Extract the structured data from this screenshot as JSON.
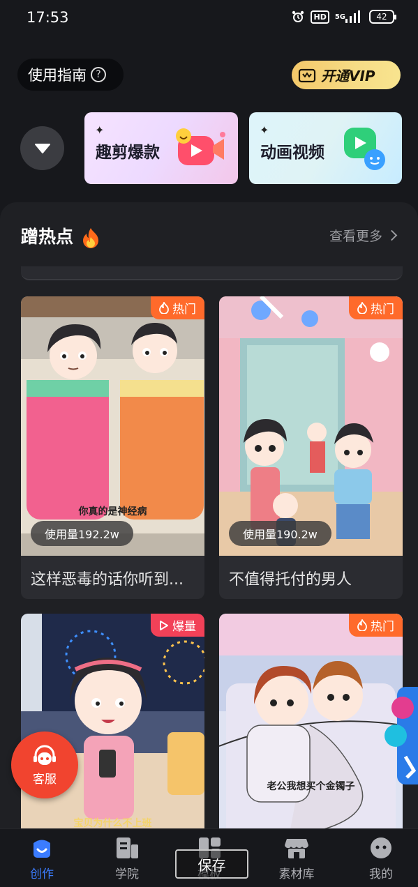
{
  "status_bar": {
    "time": "17:53",
    "hd": "HD",
    "network": "5G",
    "battery": "42"
  },
  "header": {
    "guide_label": "使用指南",
    "guide_help": "?",
    "vip_label": "开通VIP"
  },
  "quick_actions": [
    {
      "label": "趣剪爆款"
    },
    {
      "label": "动画视频"
    }
  ],
  "hot_section": {
    "title": "蹭热点",
    "more_label": "查看更多"
  },
  "cards": [
    {
      "badge": "热门",
      "usage": "使用量192.2w",
      "title": "这样恶毒的话你听到...",
      "subtitle": "你真的是神经病"
    },
    {
      "badge": "热门",
      "usage": "使用量190.2w",
      "title": "不值得托付的男人"
    },
    {
      "badge": "爆量",
      "subtitle": "宝贝为什么不上班"
    },
    {
      "badge": "热门",
      "subtitle": "老公我想买个金镯子"
    }
  ],
  "floating": {
    "service_label": "客服"
  },
  "overlay": {
    "save_label": "保存"
  },
  "tabbar": [
    {
      "label": "创作"
    },
    {
      "label": "学院"
    },
    {
      "label": "模板"
    },
    {
      "label": "素材库"
    },
    {
      "label": "我的"
    }
  ],
  "colors": {
    "accent": "#3b7cff",
    "hot": "#ff6a2b",
    "boom": "#f24158",
    "vip": "#f6dc86",
    "service": "#f1442f"
  }
}
